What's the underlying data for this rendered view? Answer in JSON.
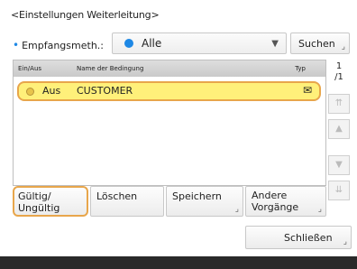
{
  "screen": {
    "title": "<Einstellungen Weiterleitung>"
  },
  "filter": {
    "label": "Empfangsmeth.:",
    "value": "Alle",
    "search_label": "Suchen"
  },
  "table": {
    "columns": [
      "Ein/Aus",
      "Name der Bedingung",
      "Typ"
    ],
    "rows": [
      {
        "onoff": "Aus",
        "name": "CUSTOMER"
      }
    ]
  },
  "pager": {
    "current": "1",
    "total": "/1"
  },
  "actions": {
    "valid_label": "Gültig/ Ungültig",
    "delete_label": "Löschen",
    "save_label": "Speichern",
    "other_label": "Andere Vorgänge",
    "close_label": "Schließen"
  },
  "icons": {
    "scroll_top": "double-up-icon",
    "scroll_up": "up-icon",
    "scroll_down": "down-icon",
    "scroll_bottom": "double-down-icon"
  },
  "colors": {
    "accent": "#1e88e5",
    "highlight": "#fff07a",
    "highlight_border": "#e8a64b"
  }
}
